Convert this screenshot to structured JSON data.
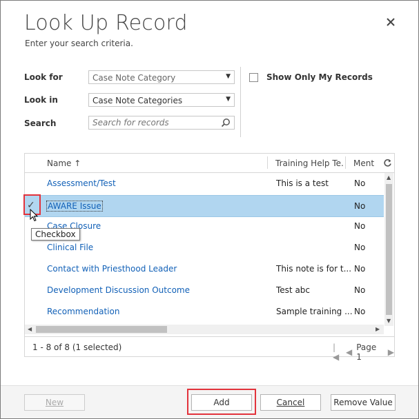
{
  "dialog": {
    "title": "Look Up Record",
    "subtitle": "Enter your search criteria."
  },
  "form": {
    "look_for_label": "Look for",
    "look_for_value": "Case Note Category",
    "look_in_label": "Look in",
    "look_in_value": "Case Note Categories",
    "search_label": "Search",
    "search_placeholder": "Search for records",
    "show_only_mine_label": "Show Only My Records"
  },
  "grid": {
    "columns": [
      "Name ↑",
      "Training Help Te...",
      "Ment"
    ],
    "rows": [
      {
        "name": "Assessment/Test",
        "help": "This is a test",
        "ment": "No"
      },
      {
        "name": "AWARE Issue",
        "help": "",
        "ment": "No"
      },
      {
        "name": "Case Closure",
        "help": "",
        "ment": "No"
      },
      {
        "name": "Clinical File",
        "help": "",
        "ment": "No"
      },
      {
        "name": "Contact with Priesthood Leader",
        "help": "This note is for t...",
        "ment": "No"
      },
      {
        "name": "Development Discussion Outcome",
        "help": "Test abc",
        "ment": "No"
      },
      {
        "name": "Recommendation",
        "help": "Sample training ...",
        "ment": "No"
      }
    ],
    "selected_check": "✓",
    "status": "1 - 8 of 8 (1 selected)",
    "page_label": "Page 1"
  },
  "tooltip": "Checkbox",
  "buttons": {
    "new": "New",
    "add": "Add",
    "cancel": "Cancel",
    "remove": "Remove Value"
  },
  "colors": {
    "link": "#1160b7",
    "selected_row": "#b1d6f0",
    "highlight": "#e2323b"
  }
}
